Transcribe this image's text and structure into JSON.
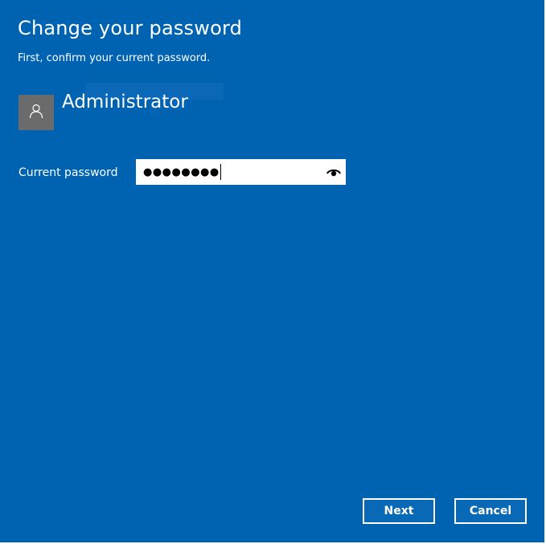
{
  "dialog": {
    "title": "Change your password",
    "subtitle": "First, confirm your current password."
  },
  "user": {
    "name": "Administrator",
    "avatar_icon": "person-icon"
  },
  "password_field": {
    "label": "Current password",
    "masked_value": "●●●●●●●●",
    "reveal_icon": "eye-icon"
  },
  "buttons": {
    "next_label": "Next",
    "cancel_label": "Cancel"
  },
  "colors": {
    "background": "#0063b1",
    "avatar_bg": "#6b6b6b",
    "text": "#ffffff"
  }
}
